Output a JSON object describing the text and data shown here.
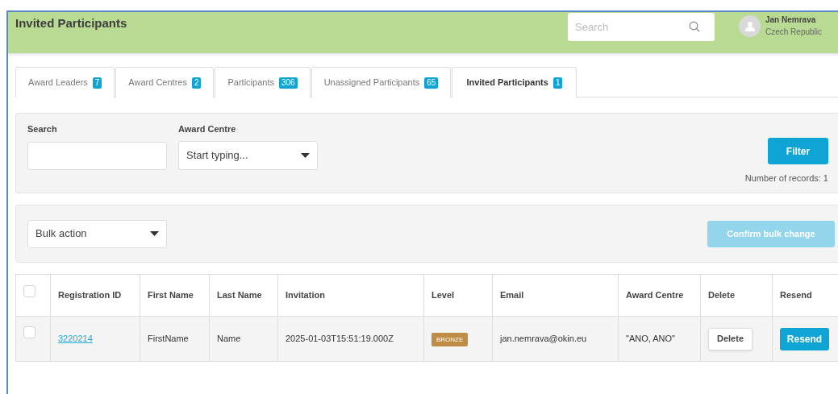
{
  "header": {
    "title": "Invited Participants",
    "search": {
      "placeholder": "Search"
    },
    "user": {
      "name": "Jan Nemrava",
      "country": "Czech Republic"
    }
  },
  "tabs": [
    {
      "label": "Award Leaders",
      "count": "7",
      "selected": false
    },
    {
      "label": "Award Centres",
      "count": "2",
      "selected": false
    },
    {
      "label": "Participants",
      "count": "306",
      "selected": false
    },
    {
      "label": "Unassigned Participants",
      "count": "65",
      "selected": false
    },
    {
      "label": "Invited Participants",
      "count": "1",
      "selected": true
    }
  ],
  "filter": {
    "search_label": "Search",
    "centre_label": "Award Centre",
    "centre_placeholder": "Start typing...",
    "button": "Filter",
    "records": "Number of records: 1"
  },
  "bulk": {
    "select": "Bulk action",
    "confirm": {
      "label": "Confirm bulk change",
      "disabled": true
    }
  },
  "table": {
    "all_checked": false,
    "columns": [
      "Registration ID",
      "First Name",
      "Last Name",
      "Invitation",
      "Level",
      "Email",
      "Award Centre",
      "Delete",
      "Resend"
    ],
    "rows": [
      {
        "checked": false,
        "id": "3220214",
        "first": "FirstName",
        "last": "Name",
        "invitation": "2025-01-03T15:51:19.000Z",
        "level": "BRONZE",
        "email": "jan.nemrava@okin.eu",
        "centre": "\"ANO, ANO\"",
        "delete": "Delete",
        "resend": "Resend"
      }
    ]
  }
}
